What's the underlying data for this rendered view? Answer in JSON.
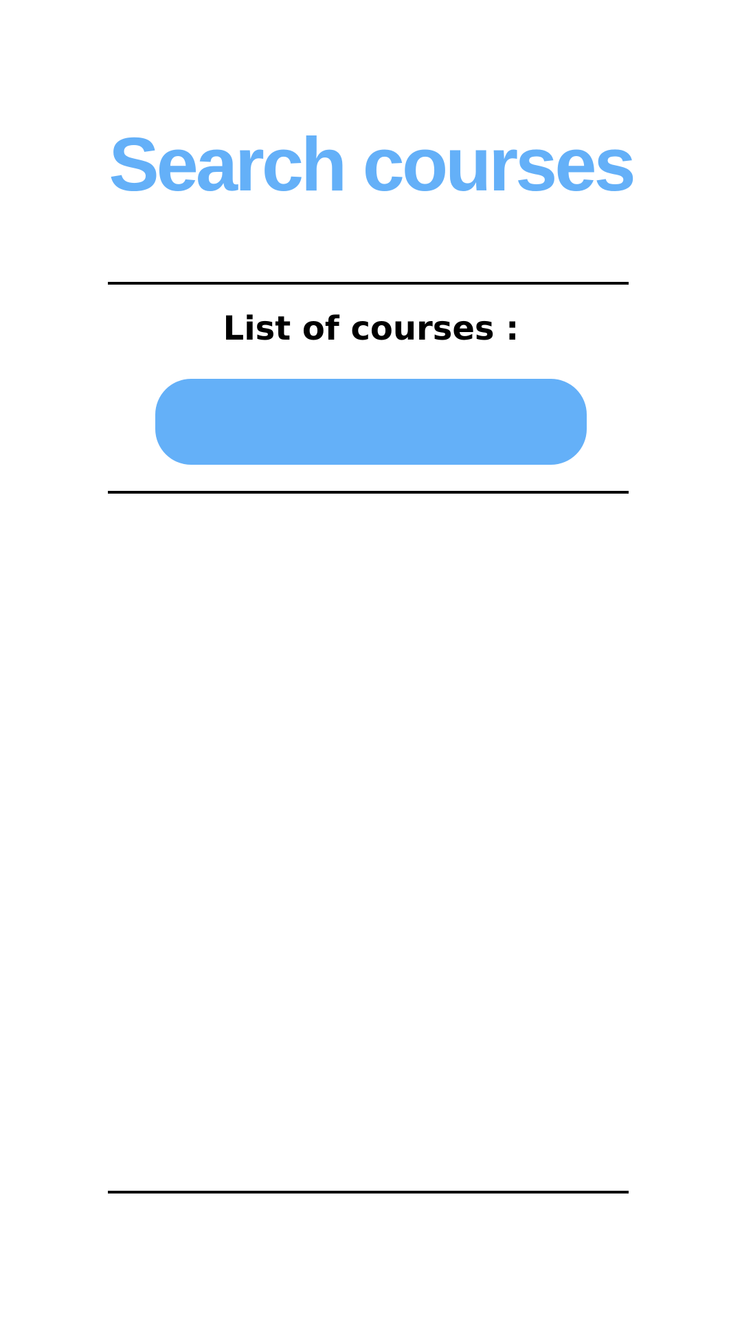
{
  "header": {
    "title": "Search courses"
  },
  "courses": {
    "heading": "List of courses  :",
    "button_label": "",
    "items": []
  },
  "colors": {
    "accent": "#64B0F8",
    "divider": "#000000",
    "background": "#ffffff",
    "heading_text": "#000000"
  }
}
